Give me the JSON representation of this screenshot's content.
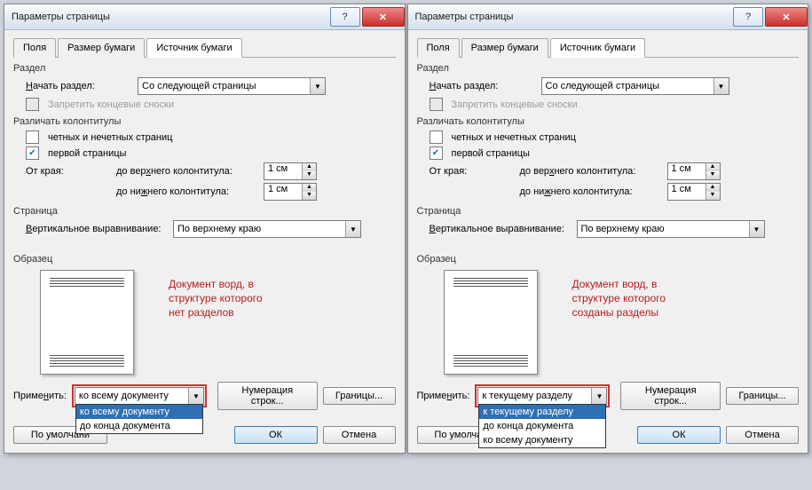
{
  "dialogs": [
    {
      "title": "Параметры страницы",
      "tabs": {
        "fields": "Поля",
        "paper": "Размер бумаги",
        "source": "Источник бумаги"
      },
      "section": {
        "label": "Раздел",
        "startSectionLabel": "Начать раздел:",
        "startSectionValue": "Со следующей страницы",
        "suppressEndnotesLabel": "Запретить концевые сноски"
      },
      "headers": {
        "label": "Различать колонтитулы",
        "oddEven": "четных и нечетных страниц",
        "firstPage": "первой страницы",
        "fromEdge": "От края:",
        "headerDist": "до верхнего колонтитула:",
        "footerDist": "до нижнего колонтитула:",
        "headerVal": "1 см",
        "footerVal": "1 см"
      },
      "page": {
        "label": "Страница",
        "vertAlignLabel": "Вертикальное выравнивание:",
        "vertAlignValue": "По верхнему краю"
      },
      "sample": {
        "label": "Образец"
      },
      "annotation": "Документ ворд, в\nструктуре которого\nнет разделов",
      "apply": {
        "label": "Применить:",
        "selected": "ко всему документу",
        "options": [
          "ко всему документу",
          "до конца документа"
        ],
        "selectedIndex": 0
      },
      "buttons": {
        "lineNumbers": "Нумерация строк...",
        "borders": "Границы...",
        "defaults": "По умолчанию",
        "ok": "ОК",
        "cancel": "Отмена"
      }
    },
    {
      "title": "Параметры страницы",
      "tabs": {
        "fields": "Поля",
        "paper": "Размер бумаги",
        "source": "Источник бумаги"
      },
      "section": {
        "label": "Раздел",
        "startSectionLabel": "Начать раздел:",
        "startSectionValue": "Со следующей страницы",
        "suppressEndnotesLabel": "Запретить концевые сноски"
      },
      "headers": {
        "label": "Различать колонтитулы",
        "oddEven": "четных и нечетных страниц",
        "firstPage": "первой страницы",
        "fromEdge": "От края:",
        "headerDist": "до верхнего колонтитула:",
        "footerDist": "до нижнего колонтитула:",
        "headerVal": "1 см",
        "footerVal": "1 см"
      },
      "page": {
        "label": "Страница",
        "vertAlignLabel": "Вертикальное выравнивание:",
        "vertAlignValue": "По верхнему краю"
      },
      "sample": {
        "label": "Образец"
      },
      "annotation": "Документ ворд, в\nструктуре которого\nсозданы разделы",
      "apply": {
        "label": "Применить:",
        "selected": "к текущему разделу",
        "options": [
          "к текущему разделу",
          "до конца документа",
          "ко всему документу"
        ],
        "selectedIndex": 0
      },
      "buttons": {
        "lineNumbers": "Нумерация строк...",
        "borders": "Границы...",
        "defaults": "По умолчанию",
        "ok": "ОК",
        "cancel": "Отмена"
      }
    }
  ]
}
